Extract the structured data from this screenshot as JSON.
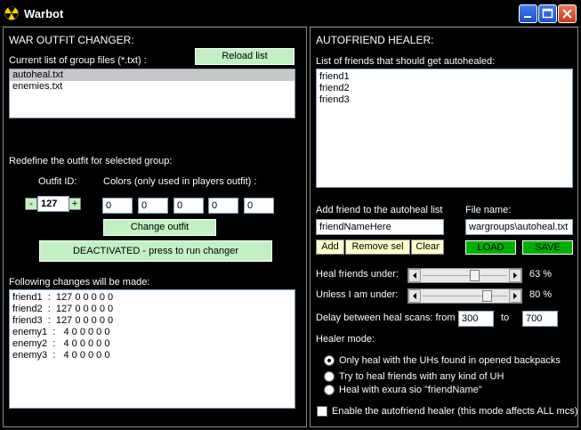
{
  "window": {
    "title": "Warbot"
  },
  "outfit": {
    "header": "WAR OUTFIT CHANGER:",
    "groups_label": "Current list of group files (*.txt) :",
    "reload_label": "Reload list",
    "group_files": [
      "autoheal.txt",
      "enemies.txt"
    ],
    "selected_group_index": 0,
    "redefine_label": "Redefine the outfit for selected group:",
    "outfit_id_label": "Outfit ID:",
    "outfit_id_value": "127",
    "minus_label": "-",
    "plus_label": "+",
    "colors_label": "Colors (only used in players outfit) :",
    "colors": [
      "0",
      "0",
      "0",
      "0",
      "0"
    ],
    "change_label": "Change outfit",
    "run_label": "DEACTIVATED - press to run changer",
    "changes_label": "Following changes will be made:",
    "changes": [
      "friend1  :  127 0 0 0 0 0",
      "friend2  :  127 0 0 0 0 0",
      "friend3  :  127 0 0 0 0 0",
      "enemy1  :   4 0 0 0 0 0",
      "enemy2  :   4 0 0 0 0 0",
      "enemy3  :   4 0 0 0 0 0"
    ]
  },
  "healer": {
    "header": "AUTOFRIEND HEALER:",
    "friends_label": "List of friends that should get autohealed:",
    "friends": [
      "friend1",
      "friend2",
      "friend3"
    ],
    "add_friend_label": "Add friend to the autoheal list",
    "add_friend_value": "friendNameHere",
    "file_name_label": "File name:",
    "file_name_value": "wargroups\\autoheal.txt",
    "add_label": "Add",
    "remove_label": "Remove sel",
    "clear_label": "Clear",
    "load_label": "LOAD",
    "save_label": "SAVE",
    "heal_under_label": "Heal friends under:",
    "heal_under_value": "63 %",
    "heal_under_level": 63,
    "unless_label": "Unless I am under:",
    "unless_value": "80 %",
    "unless_level": 80,
    "delay_label": "Delay between heal scans: from",
    "delay_from": "300",
    "delay_to_label": "to",
    "delay_to": "700",
    "mode_label": "Healer mode:",
    "modes": [
      "Only heal with the UHs found in opened backpacks",
      "Try to heal friends with any kind of UH",
      "Heal with exura sio \"friendName\""
    ],
    "selected_mode": 0,
    "enable_label": "Enable the autofriend healer (this mode affects ALL mcs)",
    "enable_checked": false
  },
  "colors": {
    "button_green": "#c2f0c2",
    "save_green": "#00b000",
    "yellow_button": "#ffffcc"
  }
}
